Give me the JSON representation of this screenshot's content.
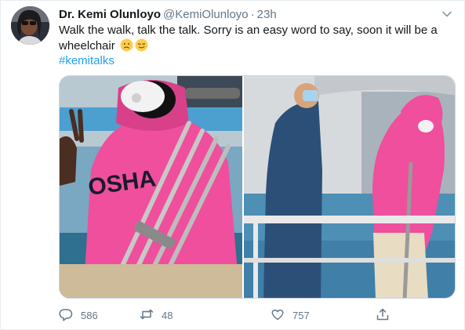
{
  "author": {
    "display_name": "Dr. Kemi Olunloyo",
    "handle": "@KemiOlunloyo",
    "separator": "·",
    "timestamp": "23h"
  },
  "tweet": {
    "text": "Walk the walk, talk the talk. Sorry is an easy word to say, soon it will be a wheelchair",
    "emojis": [
      "confused-face-emoji",
      "smirking-face-emoji"
    ],
    "hashtag": "#kemitalks"
  },
  "media": {
    "photos": [
      {
        "left_hoodie_print": "OSHA"
      },
      {}
    ]
  },
  "actions": {
    "reply": {
      "icon": "reply-icon",
      "count": "586"
    },
    "retweet": {
      "icon": "retweet-icon",
      "count": "48"
    },
    "like": {
      "icon": "heart-icon",
      "count": "757"
    },
    "share": {
      "icon": "share-icon"
    }
  },
  "colors": {
    "link": "#1da1f2",
    "secondary_text": "#657786",
    "hoodie_pink": "#ef4f9d"
  }
}
